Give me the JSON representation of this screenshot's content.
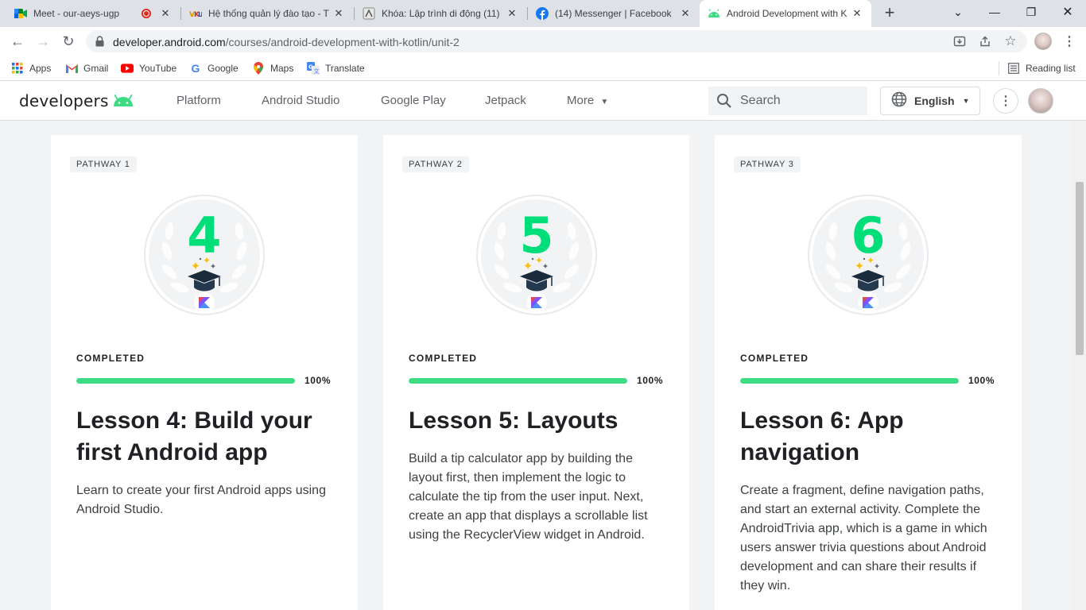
{
  "browser": {
    "tabs": [
      {
        "title": "Meet - our-aeys-ugp",
        "icon": "google-meet-icon",
        "recording": true
      },
      {
        "title": "Hệ thống quản lý đào tạo - T",
        "icon": "vku-icon"
      },
      {
        "title": "Khóa: Lập trình di động (11)",
        "icon": "moodle-icon"
      },
      {
        "title": "(14) Messenger | Facebook",
        "icon": "facebook-icon"
      },
      {
        "title": "Android Development with K",
        "icon": "android-icon",
        "active": true
      }
    ],
    "new_tab": "+",
    "url_host": "developer.android.com",
    "url_path": "/courses/android-development-with-kotlin/unit-2",
    "bookmarks": [
      {
        "label": "Apps",
        "icon": "apps-grid-icon"
      },
      {
        "label": "Gmail",
        "icon": "gmail-icon"
      },
      {
        "label": "YouTube",
        "icon": "youtube-icon"
      },
      {
        "label": "Google",
        "icon": "google-icon"
      },
      {
        "label": "Maps",
        "icon": "maps-icon"
      },
      {
        "label": "Translate",
        "icon": "translate-icon"
      }
    ],
    "reading_list": "Reading list"
  },
  "site": {
    "logo_text": "developers",
    "nav": [
      "Platform",
      "Android Studio",
      "Google Play",
      "Jetpack",
      "More"
    ],
    "search_placeholder": "Search",
    "language": "English"
  },
  "cards": [
    {
      "chip": "PATHWAY 1",
      "badge_number": "4",
      "status": "COMPLETED",
      "progress": 1.0,
      "progress_label": "100%",
      "title": "Lesson 4: Build your first Android app",
      "description": "Learn to create your first Android apps using Android Studio."
    },
    {
      "chip": "PATHWAY 2",
      "badge_number": "5",
      "status": "COMPLETED",
      "progress": 1.0,
      "progress_label": "100%",
      "title": "Lesson 5: Layouts",
      "description": "Build a tip calculator app by building the layout first, then implement the logic to calculate the tip from the user input. Next, create an app that displays a scrollable list using the RecyclerView widget in Android."
    },
    {
      "chip": "PATHWAY 3",
      "badge_number": "6",
      "status": "COMPLETED",
      "progress": 1.0,
      "progress_label": "100%",
      "title": "Lesson 6: App navigation",
      "description": "Create a fragment, define navigation paths, and start an external activity. Complete the AndroidTrivia app, which is a game in which users answer trivia questions about Android development and can share their results if they win."
    }
  ],
  "colors": {
    "accent": "#3ddc84",
    "badge_number": "#00de7a",
    "tab_strip": "#dee1e6",
    "page_bg": "#f1f3f4"
  }
}
